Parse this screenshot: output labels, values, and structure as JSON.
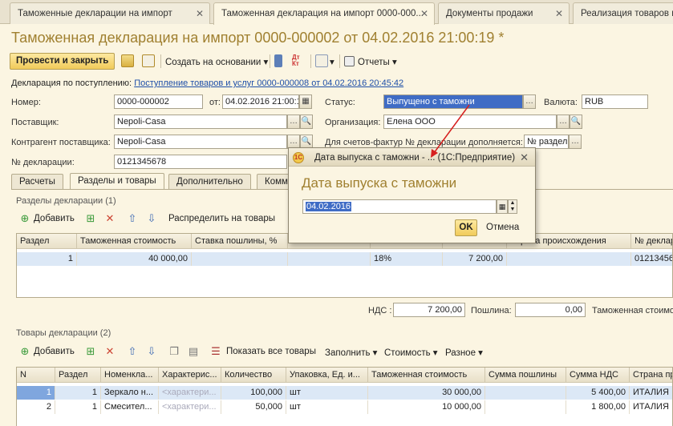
{
  "tabs": [
    {
      "label": "Таможенные декларации на импорт"
    },
    {
      "label": "Таможенная декларация на импорт 0000-000..."
    },
    {
      "label": "Документы продажи"
    },
    {
      "label": "Реализация товаров и"
    }
  ],
  "title": "Таможенная декларация на импорт 0000-000002 от 04.02.2016 21:00:19 *",
  "toolbar": {
    "post_close": "Провести и закрыть",
    "create_based": "Создать на основании",
    "reports": "Отчеты"
  },
  "basis": {
    "label": "Декларация по поступлению:",
    "link": "Поступление товаров и услуг 0000-000008 от 04.02.2016 20:45:42"
  },
  "form": {
    "number_label": "Номер:",
    "number": "0000-000002",
    "date_label": "от:",
    "date": "04.02.2016 21:00:19",
    "status_label": "Статус:",
    "status": "Выпущено с таможни",
    "currency_label": "Валюта:",
    "currency": "RUB",
    "supplier_label": "Поставщик:",
    "supplier": "Nepoli-Casa",
    "org_label": "Организация:",
    "org": "Елена ООО",
    "counterparty_label": "Контрагент поставщика:",
    "counterparty": "Nepoli-Casa",
    "invoice_label": "Для счетов-фактур № декларации дополняется:",
    "invoice_value": "№ раздел",
    "decl_label": "№ декларации:",
    "decl": "0121345678"
  },
  "section_tabs": [
    "Расчеты",
    "Разделы и товары",
    "Дополнительно",
    "Комм"
  ],
  "sections": {
    "title": "Разделы декларации (1)",
    "add": "Добавить",
    "distribute": "Распределить на товары",
    "columns": [
      "Раздел",
      "Таможенная стоимость",
      "Ставка пошлины, %",
      "",
      "",
      "",
      "Страна происхождения",
      "№ деклар"
    ],
    "row": {
      "num": "1",
      "customs_value": "40 000,00",
      "rate": "",
      "blank": "",
      "vat_rate": "18%",
      "vat": "7 200,00",
      "country": "",
      "decl": "01213456"
    },
    "vat_label": "НДС :",
    "vat_value": "7 200,00",
    "duty_label": "Пошлина:",
    "duty_value": "0,00",
    "customs_label": "Таможенная стоимо"
  },
  "goods": {
    "title": "Товары декларации (2)",
    "add": "Добавить",
    "show_all": "Показать все товары",
    "fill": "Заполнить",
    "cost": "Стоимость",
    "misc": "Разное",
    "columns": [
      "N",
      "Раздел",
      "Номенкла...",
      "Характерис...",
      "Количество",
      "Упаковка, Ед. и...",
      "Таможенная стоимость",
      "Сумма пошлины",
      "Сумма НДС",
      "Страна про"
    ],
    "rows": [
      {
        "n": "1",
        "section": "1",
        "item": "Зеркало н...",
        "char": "<характери...",
        "qty": "100,000",
        "unit": "шт",
        "customs_value": "30 000,00",
        "duty": "",
        "vat": "5 400,00",
        "country": "ИТАЛИЯ"
      },
      {
        "n": "2",
        "section": "1",
        "item": "Смесител...",
        "char": "<характери...",
        "qty": "50,000",
        "unit": "шт",
        "customs_value": "10 000,00",
        "duty": "",
        "vat": "1 800,00",
        "country": "ИТАЛИЯ"
      }
    ]
  },
  "dialog": {
    "title": "Дата выпуска с таможни - ... (1С:Предприятие)",
    "heading": "Дата выпуска с таможни",
    "value": "04.02.2016",
    "ok": "OK",
    "cancel": "Отмена"
  },
  "colors": {
    "accent": "#a08030",
    "link": "#1e4fa8",
    "selection": "#3f6cc5",
    "arrow": "#d62020"
  }
}
